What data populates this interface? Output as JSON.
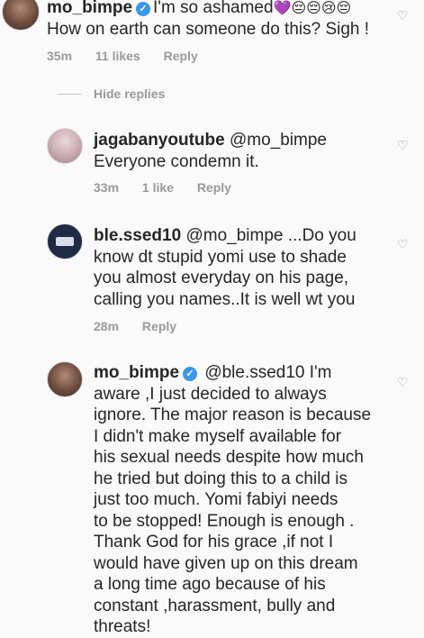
{
  "top_comment": {
    "username": "mo_bimpe",
    "text_line1": "I'm so ashamed",
    "emoji": "💜😔😔😢😔",
    "text_line2": "How on earth can someone do this? Sigh !",
    "time": "35m",
    "likes": "11 likes",
    "reply": "Reply"
  },
  "hide_replies": "Hide replies",
  "replies": [
    {
      "username": "jagabanyoutube",
      "mention": "@mo_bimpe",
      "lines": [
        "Everyone condemn it."
      ],
      "time": "33m",
      "likes": "1 like",
      "reply": "Reply"
    },
    {
      "username": "ble.ssed10",
      "mention": "@mo_bimpe ...Do you",
      "lines": [
        "know dt stupid yomi use to shade",
        "you almost everyday on his page,",
        "calling you names..It is well wt you"
      ],
      "time": "28m",
      "reply": "Reply"
    },
    {
      "username": "mo_bimpe",
      "mention": "@ble.ssed10 I'm",
      "lines": [
        "aware ,I just decided to always",
        "ignore.  The major reason is because",
        "I didn't make myself available for",
        "his sexual needs despite how much",
        "he tried but doing this to a child is",
        "just too much.  Yomi fabiyi needs",
        "to be stopped! Enough is enough .",
        "Thank God for his grace ,if not I",
        "would have given up on this dream",
        "a long time ago because of his",
        "constant ,harassment, bully and",
        "threats!"
      ]
    }
  ],
  "icons": {
    "verified": "✓",
    "heart": "♡"
  }
}
